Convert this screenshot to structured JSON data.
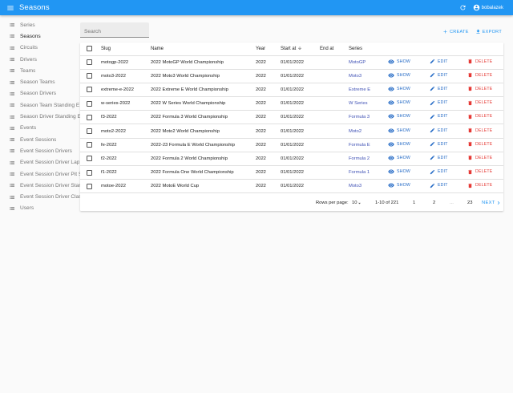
{
  "app": {
    "title": "Seasons",
    "user": "bobalazek"
  },
  "sidebar": {
    "items": [
      {
        "label": "Series"
      },
      {
        "label": "Seasons"
      },
      {
        "label": "Circuits"
      },
      {
        "label": "Drivers"
      },
      {
        "label": "Teams"
      },
      {
        "label": "Season Teams"
      },
      {
        "label": "Season Drivers"
      },
      {
        "label": "Season Team Standing E"
      },
      {
        "label": "Season Driver Standing E"
      },
      {
        "label": "Events"
      },
      {
        "label": "Event Sessions"
      },
      {
        "label": "Event Session Drivers"
      },
      {
        "label": "Event Session Driver Lap"
      },
      {
        "label": "Event Session Driver Pit S"
      },
      {
        "label": "Event Session Driver Stan"
      },
      {
        "label": "Event Session Driver Clas"
      },
      {
        "label": "Users"
      }
    ]
  },
  "search": {
    "placeholder": "Search"
  },
  "actions": {
    "create": "CREATE",
    "export": "EXPORT"
  },
  "table": {
    "headers": {
      "slug": "Slug",
      "name": "Name",
      "year": "Year",
      "start_at": "Start at",
      "end_at": "End at",
      "series": "Series"
    },
    "row_actions": {
      "show": "SHOW",
      "edit": "EDIT",
      "delete": "DELETE"
    },
    "rows": [
      {
        "slug": "motogp-2022",
        "name": "2022 MotoGP World Championship",
        "year": "2022",
        "start_at": "01/01/2022",
        "end_at": "",
        "series": "MotoGP"
      },
      {
        "slug": "moto3-2022",
        "name": "2022 Moto3 World Championship",
        "year": "2022",
        "start_at": "01/01/2022",
        "end_at": "",
        "series": "Moto3"
      },
      {
        "slug": "extreme-e-2022",
        "name": "2022 Extreme E World Championship",
        "year": "2022",
        "start_at": "01/01/2022",
        "end_at": "",
        "series": "Extreme E"
      },
      {
        "slug": "w-series-2022",
        "name": "2022 W Series World Championship",
        "year": "2022",
        "start_at": "01/01/2022",
        "end_at": "",
        "series": "W Series"
      },
      {
        "slug": "f3-2022",
        "name": "2022 Formula 3 World Championship",
        "year": "2022",
        "start_at": "01/01/2022",
        "end_at": "",
        "series": "Formula 3"
      },
      {
        "slug": "moto2-2022",
        "name": "2022 Moto2 World Championship",
        "year": "2022",
        "start_at": "01/01/2022",
        "end_at": "",
        "series": "Moto2"
      },
      {
        "slug": "fe-2022",
        "name": "2022-23 Formula E World Championship",
        "year": "2022",
        "start_at": "01/01/2022",
        "end_at": "",
        "series": "Formula E"
      },
      {
        "slug": "f2-2022",
        "name": "2022 Formula 2 World Championship",
        "year": "2022",
        "start_at": "01/01/2022",
        "end_at": "",
        "series": "Formula 2"
      },
      {
        "slug": "f1-2022",
        "name": "2022 Formula One World Championship",
        "year": "2022",
        "start_at": "01/01/2022",
        "end_at": "",
        "series": "Formula 1"
      },
      {
        "slug": "motoe-2022",
        "name": "2022 MotoE World Cup",
        "year": "2022",
        "start_at": "01/01/2022",
        "end_at": "",
        "series": "Moto3"
      }
    ]
  },
  "pagination": {
    "rows_per_page_label": "Rows per page:",
    "rows_per_page": "10",
    "range": "1-10 of 221",
    "pages": [
      "1",
      "2",
      "...",
      "23"
    ],
    "next": "NEXT"
  },
  "colors": {
    "primary": "#2196f3",
    "danger": "#e53935",
    "link": "#3f51b5"
  },
  "icons": {
    "appbar": [
      "menu-icon",
      "refresh-icon",
      "account-circle-icon"
    ],
    "sidebar": "list-icon",
    "actions": [
      "plus-icon",
      "download-icon"
    ],
    "row": [
      "eye-icon",
      "pencil-icon",
      "trash-icon"
    ],
    "sort": "arrow-down-icon",
    "select": "caret-down-icon",
    "next": "chevron-right-icon"
  }
}
